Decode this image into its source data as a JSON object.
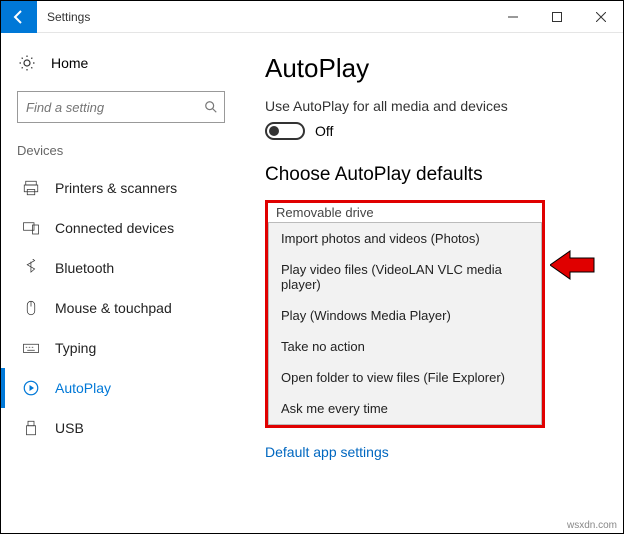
{
  "titlebar": {
    "title": "Settings"
  },
  "sidebar": {
    "home": "Home",
    "search_placeholder": "Find a setting",
    "section": "Devices",
    "items": [
      {
        "label": "Printers & scanners"
      },
      {
        "label": "Connected devices"
      },
      {
        "label": "Bluetooth"
      },
      {
        "label": "Mouse & touchpad"
      },
      {
        "label": "Typing"
      },
      {
        "label": "AutoPlay"
      },
      {
        "label": "USB"
      }
    ]
  },
  "main": {
    "title": "AutoPlay",
    "toggle_desc": "Use AutoPlay for all media and devices",
    "toggle_state": "Off",
    "defaults_title": "Choose AutoPlay defaults",
    "dropdown_label": "Removable drive",
    "options": [
      "Import photos and videos (Photos)",
      "Play video files (VideoLAN VLC media player)",
      "Play (Windows Media Player)",
      "Take no action",
      "Open folder to view files (File Explorer)",
      "Ask me every time"
    ],
    "link": "Default app settings"
  },
  "watermark": "wsxdn.com"
}
